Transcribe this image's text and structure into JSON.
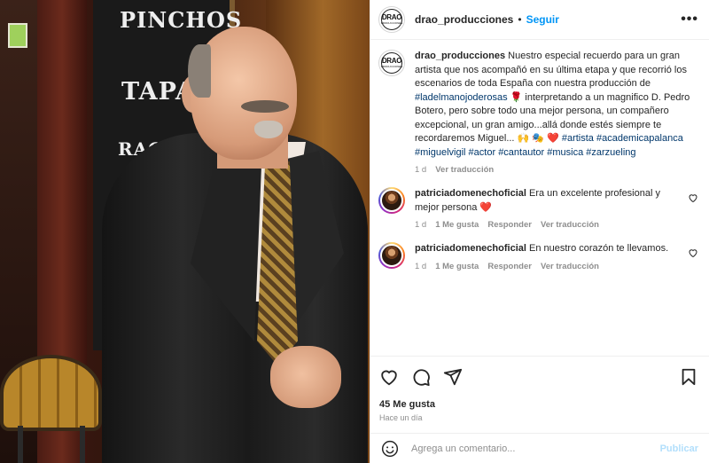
{
  "photo": {
    "board_lines": [
      "PINCHOS",
      "TAPA",
      "RAC"
    ]
  },
  "post": {
    "username": "drao_producciones",
    "separator": "•",
    "follow_label": "Seguir",
    "more_icon": "more-horizontal-icon",
    "logo": {
      "line1": "DRAO",
      "line2": "PRODUCCIONES"
    }
  },
  "caption": {
    "username": "drao_producciones",
    "text_1": "Nuestro especial recuerdo para un gran artista que nos acompañó en su última etapa y que recorrió los escenarios de toda España con nuestra producción de",
    "tag_1": "#ladelmanojoderosas",
    "emoji_1": "🌹",
    "text_2": "interpretando a un magnifico D. Pedro Botero, pero sobre todo una mejor persona, un compañero excepcional, un gran amigo...allá donde estés siempre te recordaremos Miguel...",
    "emoji_2": "🙌 🎭 ❤️",
    "tags": [
      "#artista",
      "#academicapalanca",
      "#miguelvigil",
      "#actor",
      "#cantautor",
      "#musica",
      "#zarzueling"
    ],
    "time": "1 d",
    "translate": "Ver traducción"
  },
  "comments": [
    {
      "username": "patriciadomenechoficial",
      "text": "Era un excelente profesional y mejor persona",
      "emoji": "❤️",
      "time": "1 d",
      "likes": "1 Me gusta",
      "reply": "Responder",
      "translate": "Ver traducción"
    },
    {
      "username": "patriciadomenechoficial",
      "text": "En nuestro corazón te llevamos.",
      "emoji": "",
      "time": "1 d",
      "likes": "1 Me gusta",
      "reply": "Responder",
      "translate": "Ver traducción"
    }
  ],
  "actions": {
    "like_icon": "heart-icon",
    "comment_icon": "comment-icon",
    "share_icon": "share-icon",
    "save_icon": "bookmark-icon",
    "likes": "45 Me gusta",
    "posted": "Hace un día"
  },
  "add_comment": {
    "emoji_icon": "emoji-icon",
    "placeholder": "Agrega un comentario...",
    "post_label": "Publicar",
    "post_color": "#b2dffc"
  },
  "colors": {
    "link": "#00376b",
    "accent": "#0095f6",
    "heart": "#ed4956",
    "muted": "#8e8e8e"
  }
}
